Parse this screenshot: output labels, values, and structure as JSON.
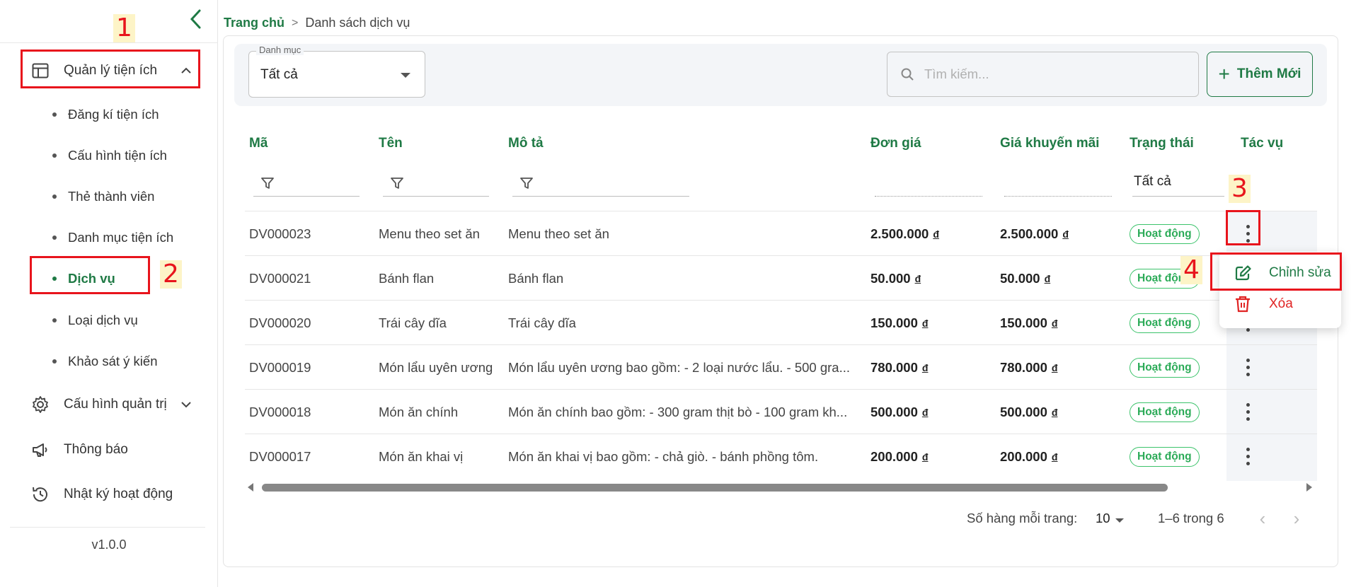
{
  "sidebar": {
    "collapse_icon": "chevron-left-icon",
    "menu_utilities": {
      "label": "Quản lý tiện ích",
      "icon": "table-layout-icon"
    },
    "sub_items": [
      {
        "label": "Đăng kí tiện ích"
      },
      {
        "label": "Cấu hình tiện ích"
      },
      {
        "label": "Thẻ thành viên"
      },
      {
        "label": "Danh mục tiện ích"
      },
      {
        "label": "Dịch vụ"
      },
      {
        "label": "Loại dịch vụ"
      },
      {
        "label": "Khảo sát ý kiến"
      }
    ],
    "menu_admin": {
      "label": "Cấu hình quản trị",
      "icon": "gear-icon"
    },
    "menu_notify": {
      "label": "Thông báo",
      "icon": "megaphone-icon"
    },
    "menu_log": {
      "label": "Nhật ký hoạt động",
      "icon": "history-icon"
    },
    "version": "v1.0.0"
  },
  "breadcrumb": {
    "home": "Trang chủ",
    "separator": ">",
    "current": "Danh sách dịch vụ"
  },
  "filters": {
    "category_label": "Danh mục",
    "category_value": "Tất cả",
    "search_placeholder": "Tìm kiếm...",
    "add_button": "Thêm Mới"
  },
  "table": {
    "headers": {
      "code": "Mã",
      "name": "Tên",
      "desc": "Mô tả",
      "price": "Đơn giá",
      "promo": "Giá khuyến mãi",
      "status": "Trạng thái",
      "action": "Tác vụ"
    },
    "status_filter": "Tất cả",
    "currency": "đ",
    "rows": [
      {
        "code": "DV000023",
        "name": "Menu theo set ăn",
        "desc": "Menu theo set ăn",
        "price": "2.500.000",
        "promo": "2.500.000",
        "status": "Hoạt động"
      },
      {
        "code": "DV000021",
        "name": "Bánh flan",
        "desc": "Bánh flan",
        "price": "50.000",
        "promo": "50.000",
        "status": "Hoạt động"
      },
      {
        "code": "DV000020",
        "name": "Trái cây dĩa",
        "desc": "Trái cây dĩa",
        "price": "150.000",
        "promo": "150.000",
        "status": "Hoạt động"
      },
      {
        "code": "DV000019",
        "name": "Món lẩu uyên ương",
        "desc": "Món lẩu uyên ương bao gồm: - 2 loại nước lẩu. - 500 gra...",
        "price": "780.000",
        "promo": "780.000",
        "status": "Hoạt động"
      },
      {
        "code": "DV000018",
        "name": "Món ăn chính",
        "desc": "Món ăn chính bao gồm: - 300 gram thịt bò - 100 gram kh...",
        "price": "500.000",
        "promo": "500.000",
        "status": "Hoạt động"
      },
      {
        "code": "DV000017",
        "name": "Món ăn khai vị",
        "desc": "Món ăn khai vị bao gồm: - chả giò. - bánh phồng tôm.",
        "price": "200.000",
        "promo": "200.000",
        "status": "Hoạt động"
      }
    ]
  },
  "pagination": {
    "rows_per_page_label": "Số hàng mỗi trang:",
    "rows_per_page": "10",
    "range": "1–6 trong 6",
    "prev": "‹",
    "next": "›"
  },
  "context_menu": {
    "edit": "Chỉnh sửa",
    "delete": "Xóa"
  },
  "annotations": {
    "n1": "1",
    "n2": "2",
    "n3": "3",
    "n4": "4"
  },
  "colors": {
    "brand": "#1f7a45",
    "danger": "#e02424",
    "annotation": "#e8141c",
    "badge": "#2cab58"
  }
}
